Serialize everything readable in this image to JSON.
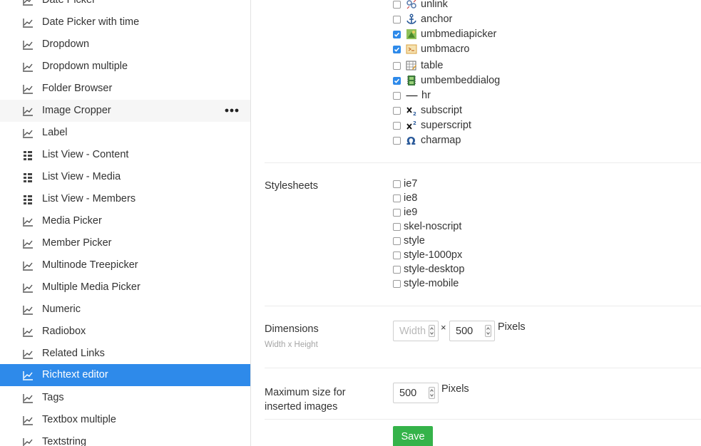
{
  "sidebar": {
    "items": [
      {
        "label": "Date Picker",
        "icon": "chart-line-icon"
      },
      {
        "label": "Date Picker with time",
        "icon": "chart-line-icon"
      },
      {
        "label": "Dropdown",
        "icon": "chart-line-icon"
      },
      {
        "label": "Dropdown multiple",
        "icon": "chart-line-icon"
      },
      {
        "label": "Folder Browser",
        "icon": "chart-line-icon"
      },
      {
        "label": "Image Cropper",
        "icon": "chart-line-icon",
        "state": "hover"
      },
      {
        "label": "Label",
        "icon": "chart-line-icon"
      },
      {
        "label": "List View - Content",
        "icon": "list-view-icon"
      },
      {
        "label": "List View - Media",
        "icon": "list-view-icon"
      },
      {
        "label": "List View - Members",
        "icon": "list-view-icon"
      },
      {
        "label": "Media Picker",
        "icon": "chart-line-icon"
      },
      {
        "label": "Member Picker",
        "icon": "chart-line-icon"
      },
      {
        "label": "Multinode Treepicker",
        "icon": "chart-line-icon"
      },
      {
        "label": "Multiple Media Picker",
        "icon": "chart-line-icon"
      },
      {
        "label": "Numeric",
        "icon": "chart-line-icon"
      },
      {
        "label": "Radiobox",
        "icon": "chart-line-icon"
      },
      {
        "label": "Related Links",
        "icon": "chart-line-icon"
      },
      {
        "label": "Richtext editor",
        "icon": "chart-line-icon",
        "state": "selected"
      },
      {
        "label": "Tags",
        "icon": "chart-line-icon"
      },
      {
        "label": "Textbox multiple",
        "icon": "chart-line-icon"
      },
      {
        "label": "Textstring",
        "icon": "chart-line-icon"
      }
    ]
  },
  "toolbar": {
    "items": [
      {
        "label": "unlink",
        "checked": false,
        "icon": "unlink-icon"
      },
      {
        "label": "anchor",
        "checked": false,
        "icon": "anchor-icon"
      },
      {
        "label": "umbmediapicker",
        "checked": true,
        "icon": "media-picker-icon"
      },
      {
        "label": "umbmacro",
        "checked": true,
        "icon": "macro-icon"
      },
      {
        "label": "table",
        "checked": false,
        "icon": "table-icon"
      },
      {
        "label": "umbembeddialog",
        "checked": true,
        "icon": "embed-dialog-icon"
      },
      {
        "label": "hr",
        "checked": false,
        "icon": "horizontal-rule-icon"
      },
      {
        "label": "subscript",
        "checked": false,
        "icon": "subscript-icon"
      },
      {
        "label": "superscript",
        "checked": false,
        "icon": "superscript-icon"
      },
      {
        "label": "charmap",
        "checked": false,
        "icon": "omega-icon"
      }
    ]
  },
  "stylesheets": {
    "label": "Stylesheets",
    "items": [
      {
        "label": "ie7",
        "checked": false
      },
      {
        "label": "ie8",
        "checked": false
      },
      {
        "label": "ie9",
        "checked": false
      },
      {
        "label": "skel-noscript",
        "checked": false
      },
      {
        "label": "style",
        "checked": false
      },
      {
        "label": "style-1000px",
        "checked": false
      },
      {
        "label": "style-desktop",
        "checked": false
      },
      {
        "label": "style-mobile",
        "checked": false
      }
    ]
  },
  "dimensions": {
    "label": "Dimensions",
    "description": "Width x Height",
    "width_value": "",
    "width_placeholder": "Width",
    "separator": "×",
    "height_value": "500",
    "unit": "Pixels"
  },
  "max_image_size": {
    "label": "Maximum size for inserted images",
    "value": "500",
    "unit": "Pixels"
  },
  "save_label": "Save",
  "colors": {
    "selected": "#2e8aea",
    "hover": "#f6f6f6",
    "save": "#35b34a",
    "checkbox_on": "#2e8aea"
  }
}
